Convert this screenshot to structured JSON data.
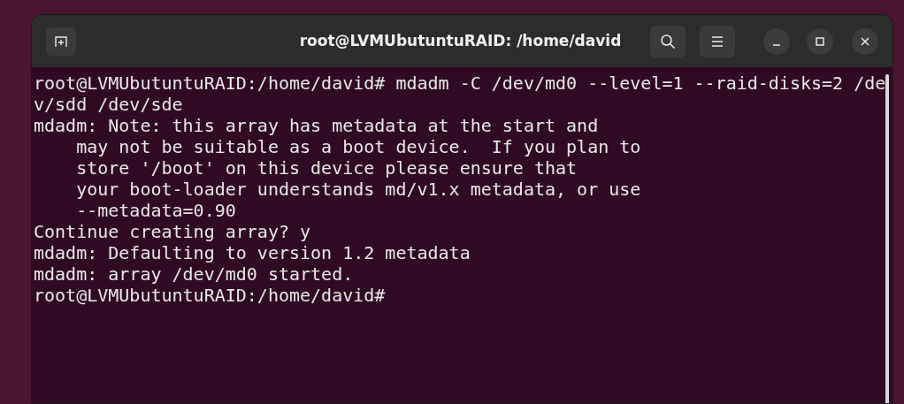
{
  "window": {
    "title": "root@LVMUbutuntuRAID: /home/david"
  },
  "terminal": {
    "lines": [
      "root@LVMUbutuntuRAID:/home/david# mdadm -C /dev/md0 --level=1 --raid-disks=2 /de",
      "v/sdd /dev/sde",
      "mdadm: Note: this array has metadata at the start and",
      "    may not be suitable as a boot device.  If you plan to",
      "    store '/boot' on this device please ensure that",
      "    your boot-loader understands md/v1.x metadata, or use",
      "    --metadata=0.90",
      "Continue creating array? y",
      "mdadm: Defaulting to version 1.2 metadata",
      "mdadm: array /dev/md0 started.",
      "root@LVMUbutuntuRAID:/home/david#"
    ]
  }
}
